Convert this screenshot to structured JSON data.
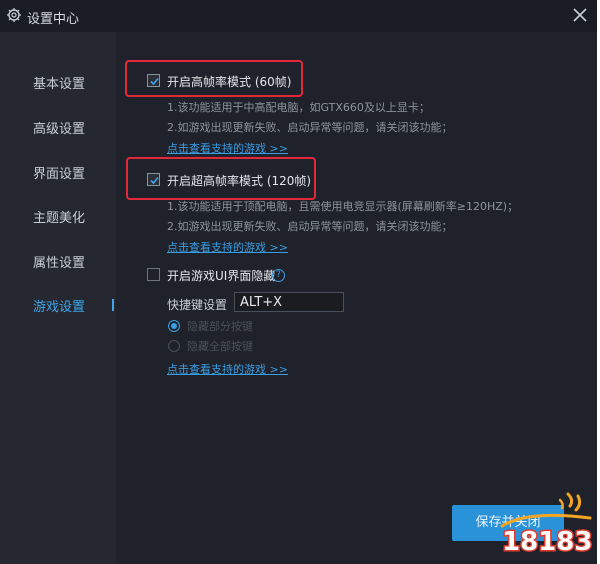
{
  "window": {
    "title": "设置中心"
  },
  "sidebar": {
    "items": [
      {
        "label": "基本设置"
      },
      {
        "label": "高级设置"
      },
      {
        "label": "界面设置"
      },
      {
        "label": "主题美化"
      },
      {
        "label": "属性设置"
      },
      {
        "label": "游戏设置",
        "active": true
      }
    ]
  },
  "options": {
    "fps60": {
      "label": "开启高帧率模式 (60帧)",
      "checked": true,
      "desc1": "1.该功能适用于中高配电脑，如GTX660及以上显卡；",
      "desc2": "2.如游戏出现更新失败、启动异常等问题，请关闭该功能；",
      "link": "点击查看支持的游戏 >>"
    },
    "fps120": {
      "label": "开启超高帧率模式 (120帧)",
      "checked": true,
      "desc1": "1.该功能适用于顶配电脑，且需使用电竞显示器(屏幕刷新率≥120HZ)；",
      "desc2": "2.如游戏出现更新失败、启动异常等问题，请关闭该功能；",
      "link": "点击查看支持的游戏 >>"
    },
    "hide_ui": {
      "label": "开启游戏UI界面隐藏",
      "checked": false,
      "help": "?",
      "hotkey_label": "快捷键设置",
      "hotkey_value": "ALT+X",
      "radio1": "隐藏部分按键",
      "radio2": "隐藏全部按键",
      "link": "点击查看支持的游戏 >>"
    }
  },
  "footer": {
    "save_label": "保存并关闭"
  },
  "watermark": {
    "text": "18183"
  },
  "colors": {
    "accent": "#3a9ee4",
    "highlight": "#e3283a",
    "background": "#1f222a"
  }
}
